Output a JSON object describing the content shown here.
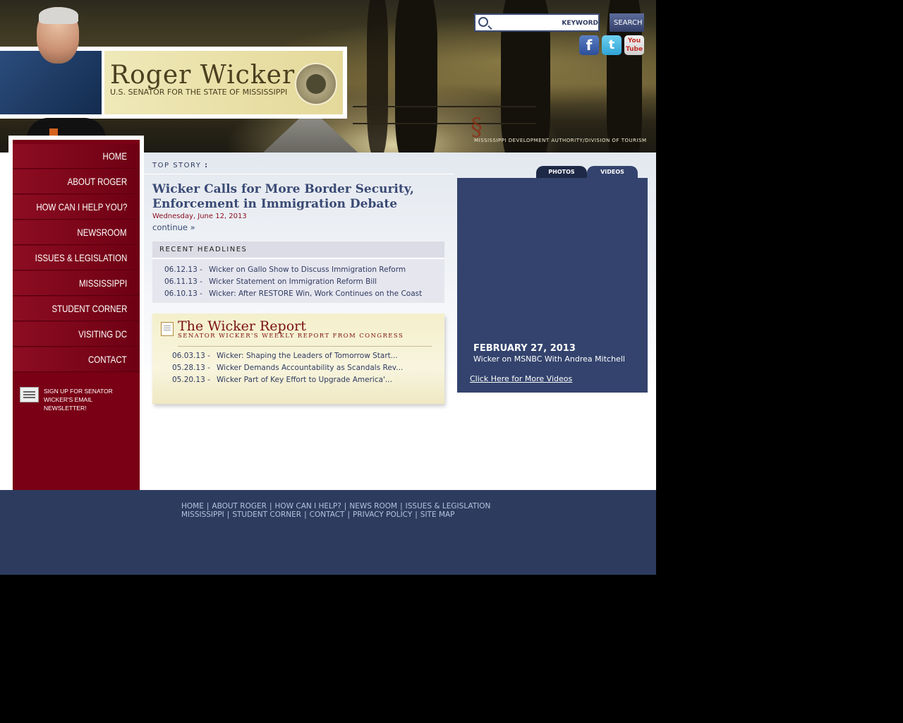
{
  "header": {
    "senator_name": "Roger Wicker",
    "senator_subtitle": "U.S. SENATOR FOR THE STATE OF  MISSISSIPPI",
    "search_placeholder": "KEYWORD",
    "search_button": "SEARCH",
    "tourism_credit": "MISSISSIPPI DEVELOPMENT AUTHORITY/DIVISION OF TOURISM",
    "social": {
      "facebook": "f",
      "twitter": "t",
      "youtube": "You Tube"
    }
  },
  "nav": {
    "items": [
      {
        "label": "HOME"
      },
      {
        "label": "ABOUT ROGER"
      },
      {
        "label": "HOW CAN I HELP YOU?"
      },
      {
        "label": "NEWSROOM"
      },
      {
        "label": "ISSUES & LEGISLATION"
      },
      {
        "label": "MISSISSIPPI"
      },
      {
        "label": "STUDENT CORNER"
      },
      {
        "label": "VISITING DC"
      },
      {
        "label": "CONTACT"
      }
    ],
    "newsletter_line1": "SIGN UP FOR SENATOR",
    "newsletter_line2": "WICKER'S EMAIL NEWSLETTER!"
  },
  "top_story": {
    "label": "TOP STORY",
    "title": "Wicker Calls for More Border Security, Enforcement in Immigration Debate",
    "date": "Wednesday, June 12, 2013",
    "continue": "continue »"
  },
  "recent_headlines": {
    "title": "RECENT HEADLINES",
    "items": [
      {
        "date": "06.12.13 -",
        "text": "Wicker on Gallo Show to Discuss Immigration Reform"
      },
      {
        "date": "06.11.13 -",
        "text": "Wicker Statement on Immigration Reform Bill"
      },
      {
        "date": "06.10.13 -",
        "text": "Wicker: After RESTORE Win, Work Continues on the Coast"
      }
    ]
  },
  "wicker_report": {
    "title": "The Wicker Report",
    "subtitle": "SENATOR WICKER'S WEEKLY REPORT FROM CONGRESS",
    "items": [
      {
        "date": "06.03.13 -",
        "text": "Wicker: Shaping the Leaders of Tomorrow Start..."
      },
      {
        "date": "05.28.13 -",
        "text": "Wicker Demands Accountability as Scandals Rev..."
      },
      {
        "date": "05.20.13 -",
        "text": "Wicker Part of Key Effort to Upgrade America'..."
      }
    ]
  },
  "media": {
    "tabs": [
      "PHOTOS",
      "VIDEOS"
    ],
    "video_date": "FEBRUARY 27, 2013",
    "video_caption": "Wicker on MSNBC With Andrea Mitchell",
    "more_link": "Click Here for More Videos"
  },
  "footer": {
    "row1": [
      "HOME",
      "ABOUT ROGER",
      "HOW CAN I HELP?",
      "NEWS ROOM",
      "ISSUES & LEGISLATION"
    ],
    "row2": [
      "MISSISSIPPI",
      "STUDENT CORNER",
      "CONTACT",
      "PRIVACY POLICY",
      "SITE MAP"
    ]
  }
}
